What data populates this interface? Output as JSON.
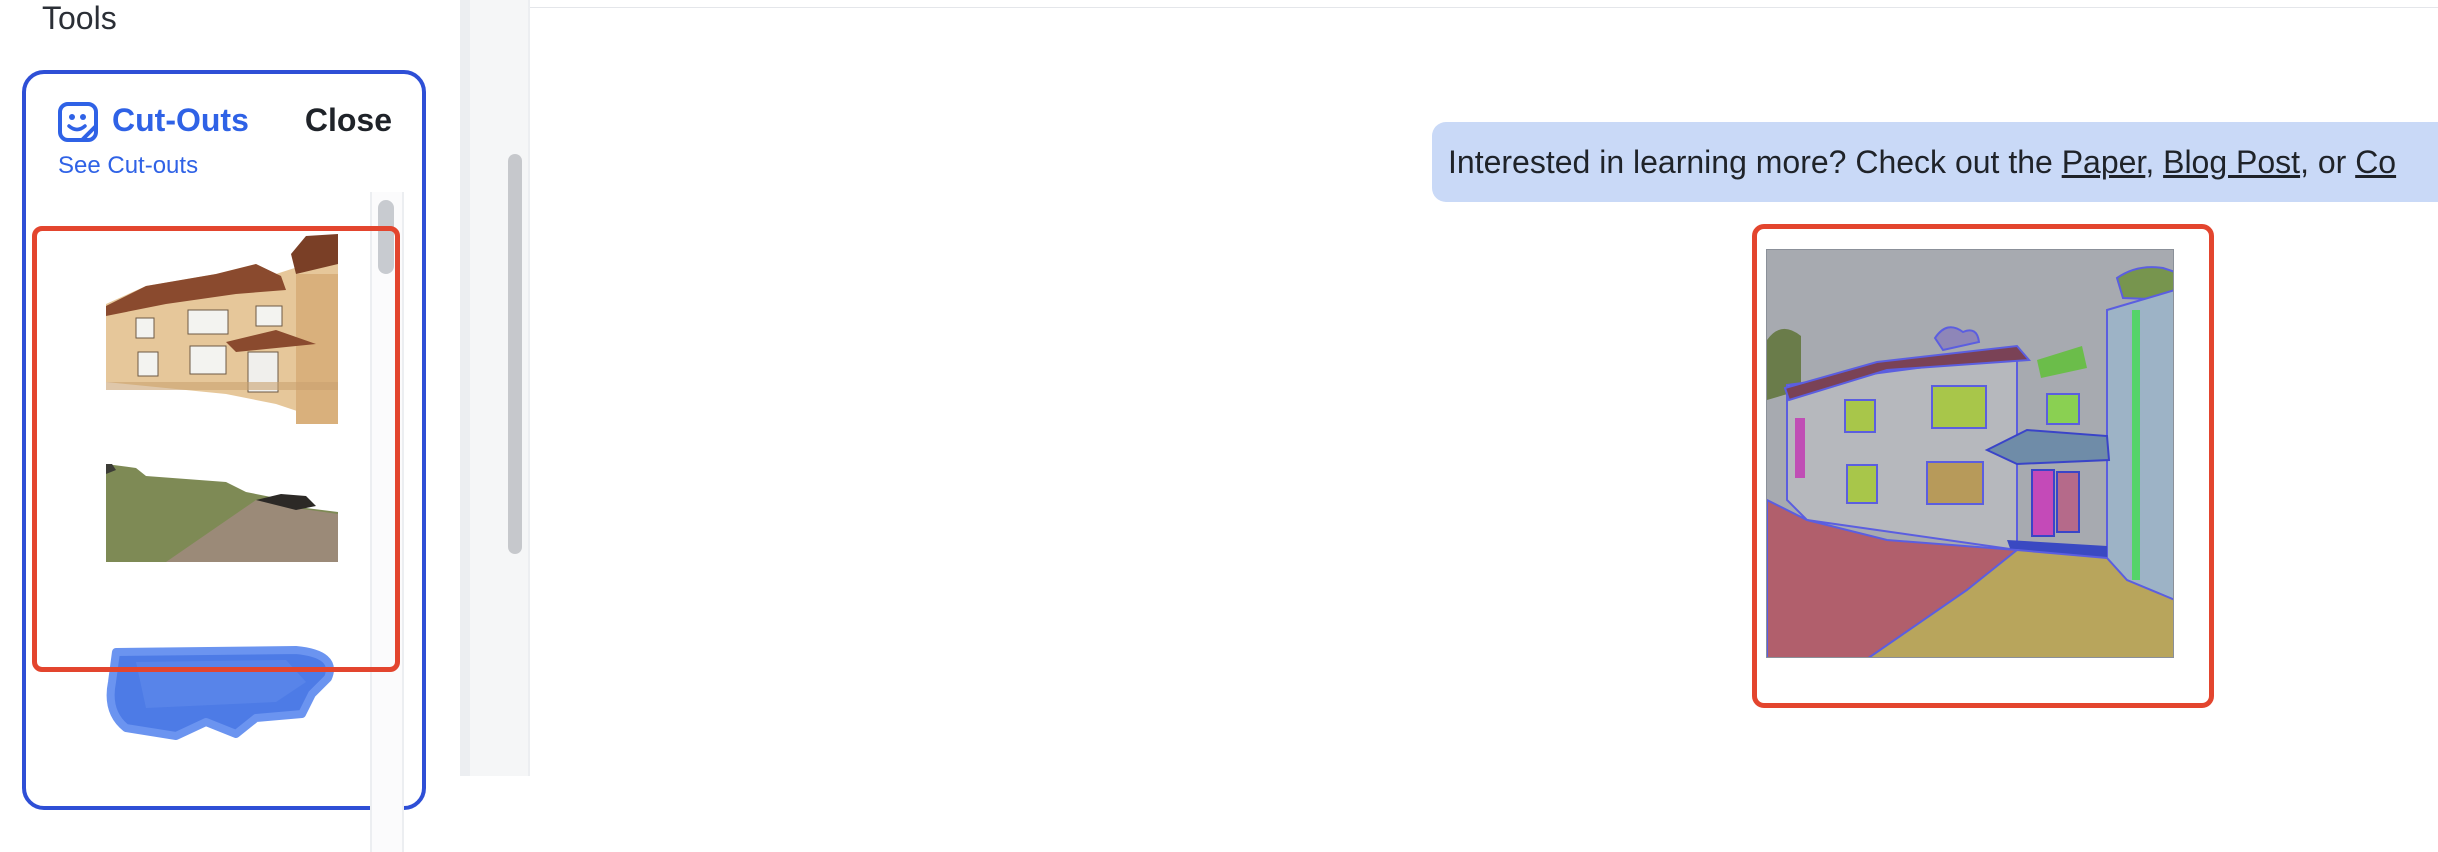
{
  "sidebar": {
    "title": "Tools",
    "cutouts": {
      "icon": "cutouts-icon",
      "title": "Cut-Outs",
      "close_label": "Close",
      "see_link": "See Cut-outs"
    }
  },
  "banner": {
    "text_prefix": "Interested in learning more? Check out the ",
    "paper_link": "Paper",
    "sep1": ", ",
    "blog_link": "Blog Post",
    "sep2": ", or ",
    "code_link": "Co"
  },
  "colors": {
    "accent": "#2f62e6",
    "card_border": "#2e4fd6",
    "selection": "#e3452e",
    "banner_bg": "#c9d9f7"
  }
}
